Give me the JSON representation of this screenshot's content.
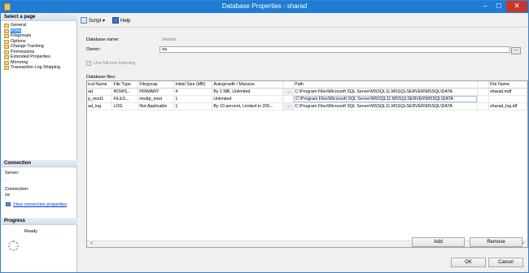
{
  "window": {
    "title": "Database Properties - sharad"
  },
  "left": {
    "select_page_header": "Select a page",
    "pages": [
      "General",
      "Files",
      "Filegroups",
      "Options",
      "Change Tracking",
      "Permissions",
      "Extended Properties",
      "Mirroring",
      "Transaction Log Shipping"
    ],
    "selected_page": "Files",
    "connection_header": "Connection",
    "server_label": "Server:",
    "server_value": ".",
    "connection_label": "Connection:",
    "connection_value": "sa",
    "view_connection_link": "View connection properties",
    "progress_header": "Progress",
    "progress_status": "Ready"
  },
  "toolbar": {
    "script_label": "Script",
    "help_label": "Help"
  },
  "form": {
    "database_name_label": "Database name:",
    "database_name_value": "sharad",
    "owner_label": "Owner:",
    "owner_value": "sa",
    "fulltext_label": "Use full-text indexing",
    "database_files_label": "Database files:"
  },
  "files_table": {
    "columns": [
      "ical Name",
      "File Type",
      "Filegroup",
      "Initial Size (MB)",
      "Autogrowth / Maxsize",
      "",
      "Path",
      "",
      "File Name"
    ],
    "rows": [
      [
        "ad",
        "ROWS...",
        "PRIMARY",
        "4",
        "By 1 MB, Unlimited",
        "...",
        "C:\\Program Files\\Microsoft SQL Server\\MSSQL11.MSSQLSERVER\\MSSQL\\DATA",
        "",
        "sharad.mdf"
      ],
      [
        "p_mod1",
        "FILES...",
        "imoltp_mod",
        "1",
        "Unlimited",
        "",
        "C:\\Program Files\\Microsoft SQL Server\\MSSQL11.MSSQLSERVER\\MSSQL\\DATA",
        "",
        ""
      ],
      [
        "ad_log",
        "LOG",
        "Not Applicable",
        "1",
        "By 10 percent, Limited to 209...",
        "...",
        "C:\\Program Files\\Microsoft SQL Server\\MSSQL11.MSSQLSERVER\\MSSQL\\DATA",
        "",
        "sharad_log.ldf"
      ]
    ]
  },
  "buttons": {
    "add": "Add",
    "remove": "Remove",
    "ok": "OK",
    "cancel": "Cancel"
  }
}
